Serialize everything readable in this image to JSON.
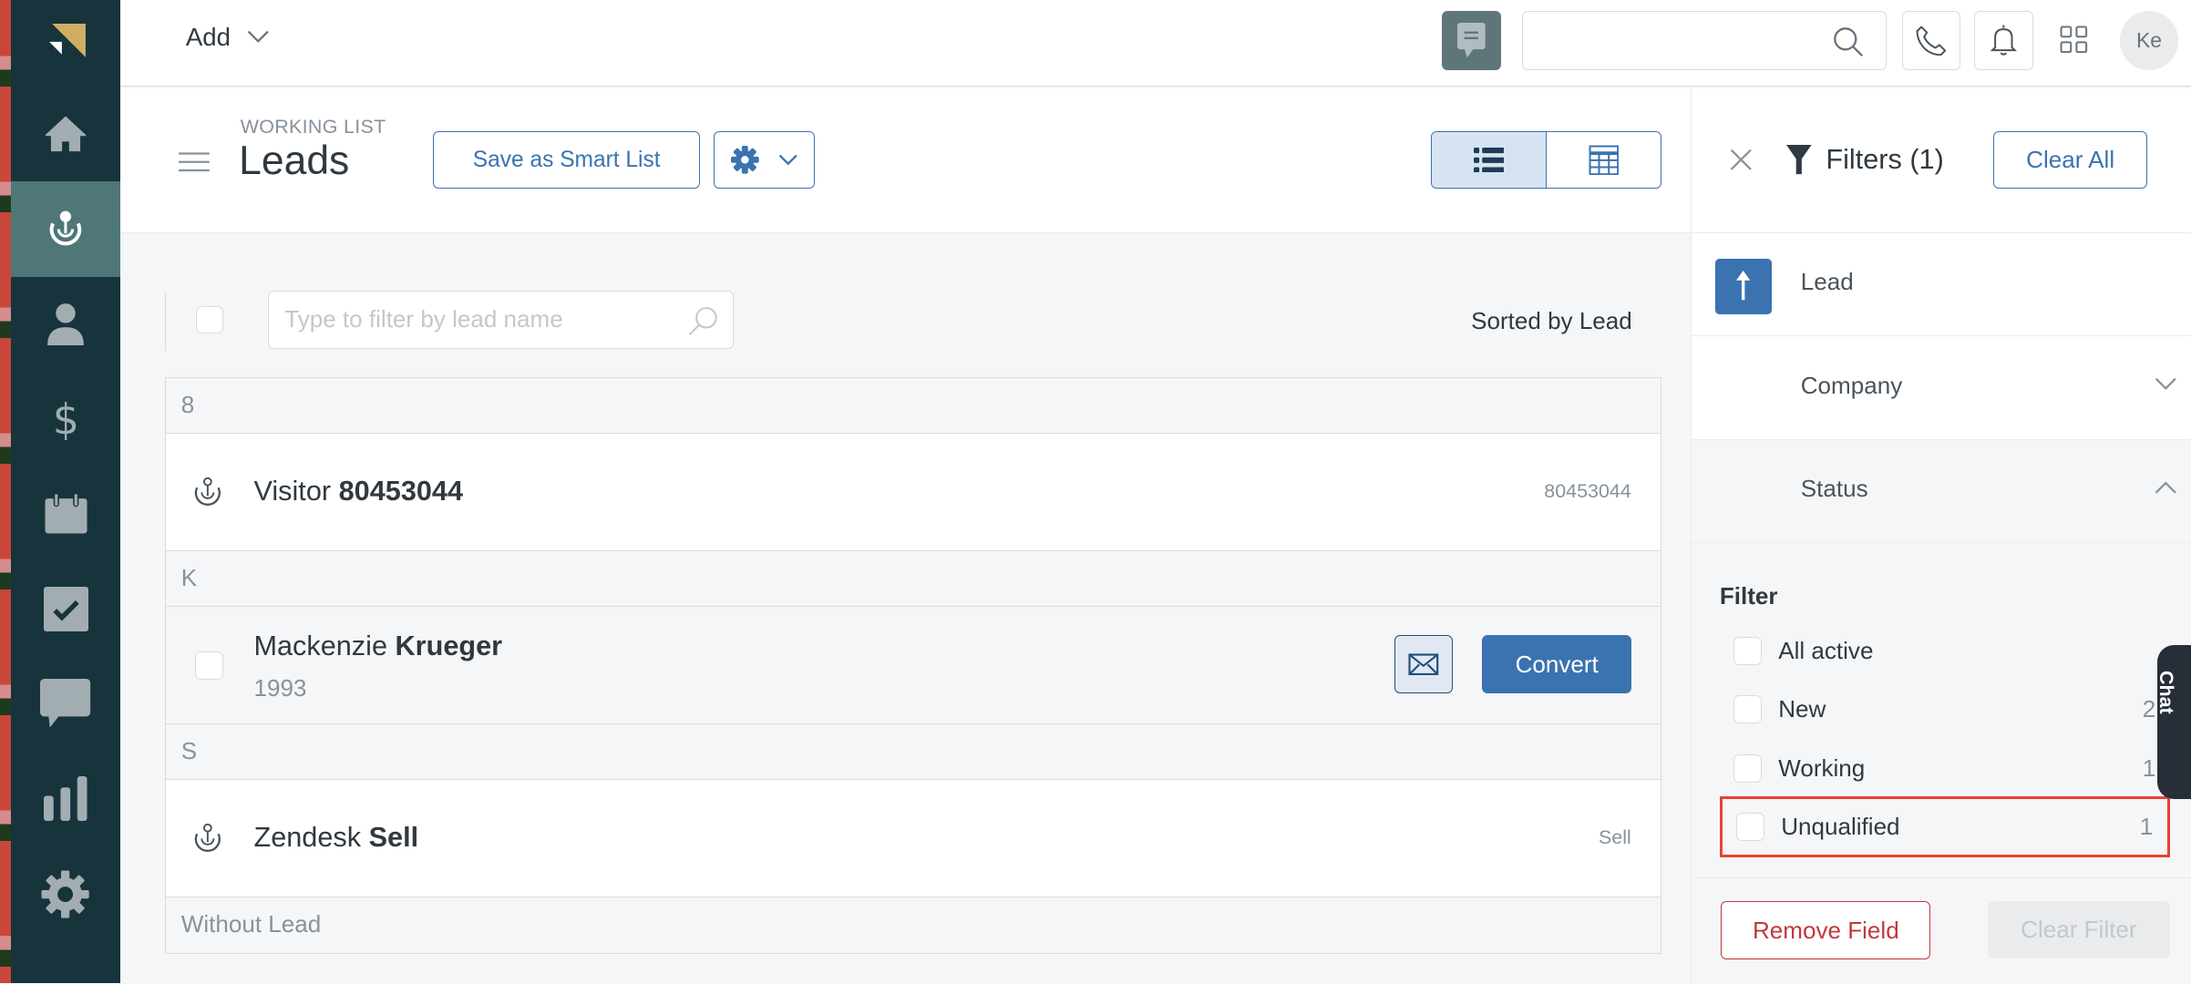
{
  "nav": {
    "items": [
      {
        "name": "home",
        "active": false
      },
      {
        "name": "leads",
        "active": true
      },
      {
        "name": "contacts",
        "active": false
      },
      {
        "name": "deals",
        "active": false
      },
      {
        "name": "calendar",
        "active": false
      },
      {
        "name": "tasks",
        "active": false
      },
      {
        "name": "communication",
        "active": false
      },
      {
        "name": "reports",
        "active": false
      },
      {
        "name": "settings",
        "active": false
      }
    ]
  },
  "topbar": {
    "add_label": "Add",
    "search_placeholder": "",
    "avatar_initials": "Ke"
  },
  "header": {
    "eyebrow": "WORKING LIST",
    "title": "Leads",
    "save_smart_list_label": "Save as Smart List"
  },
  "list": {
    "filter_placeholder": "Type to filter by lead name",
    "sorted_label": "Sorted by Lead",
    "groups": [
      {
        "letter": "8",
        "rows": [
          {
            "first": "Visitor",
            "last": "80453044",
            "right": "80453044"
          }
        ]
      },
      {
        "letter": "K",
        "rows": [
          {
            "first": "Mackenzie",
            "last": "Krueger",
            "sub": "1993",
            "action": "Convert"
          }
        ]
      },
      {
        "letter": "S",
        "rows": [
          {
            "first": "Zendesk",
            "last": "Sell",
            "right": "Sell"
          }
        ]
      },
      {
        "letter": "Without Lead",
        "rows": []
      }
    ]
  },
  "filters": {
    "title": "Filters (1)",
    "clear_all_label": "Clear All",
    "fields": [
      {
        "label": "Lead",
        "sorted": true
      },
      {
        "label": "Company",
        "expanded": false
      },
      {
        "label": "Status",
        "expanded": true
      }
    ],
    "filter_heading": "Filter",
    "options": [
      {
        "label": "All active",
        "count": "",
        "checked": false
      },
      {
        "label": "New",
        "count": "2",
        "checked": false
      },
      {
        "label": "Working",
        "count": "1",
        "checked": false
      },
      {
        "label": "Unqualified",
        "count": "1",
        "checked": false,
        "highlighted": true
      }
    ],
    "remove_field_label": "Remove Field",
    "clear_filter_label": "Clear Filter"
  },
  "chat_widget": {
    "label": "Chat"
  },
  "colors": {
    "nav_bg": "#17343c",
    "nav_active": "#4f7778",
    "accent": "#3a73b0",
    "danger": "#c0393b",
    "highlight": "#e8432f"
  }
}
